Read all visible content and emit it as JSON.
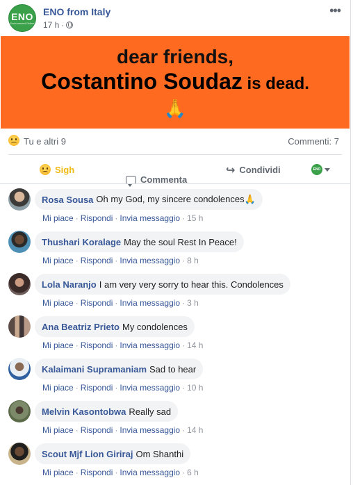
{
  "post": {
    "page_name": "ENO from Italy",
    "avatar_text": "ENO",
    "avatar_subtext": "Environment Online",
    "time": "17 h",
    "dot": "·",
    "more_label": "•••"
  },
  "banner": {
    "line1": "dear friends,",
    "name": "Costantino Soudaz",
    "line2_rest": " is dead.",
    "emoji": "🙏",
    "background": "#ff6a21"
  },
  "reactions": {
    "summary": "Tu e altri 9",
    "comments": "Commenti: 7",
    "icon": "sad-icon"
  },
  "actions": {
    "sigh": "Sigh",
    "comment": "Commenta",
    "share": "Condividi",
    "share_icon": "↪"
  },
  "comment_action_labels": {
    "like": "Mi piace",
    "reply": "Rispondi",
    "message": "Invia messaggio",
    "sep": "·"
  },
  "comments": [
    {
      "author": "Rosa Sousa",
      "text": "Oh my God, my sincere condolences🙏",
      "time": "15 h"
    },
    {
      "author": "Thushari Koralage",
      "text": "May the soul Rest In Peace!",
      "time": "8 h"
    },
    {
      "author": "Lola Naranjo",
      "text": "I am very very sorry to hear this. Condolences",
      "time": "3 h"
    },
    {
      "author": "Ana Beatriz Prieto",
      "text": "My condolences",
      "time": "14 h"
    },
    {
      "author": "Kalaimani Supramaniam",
      "text": "Sad to hear",
      "time": "10 h"
    },
    {
      "author": "Melvin Kasontobwa",
      "text": "Really sad",
      "time": "14 h"
    },
    {
      "author": "Scout Mjf Lion Giriraj",
      "text": "Om Shanthi",
      "time": "6 h"
    }
  ],
  "colors": {
    "link_blue": "#385898",
    "banner_orange": "#ff6a21",
    "eno_green": "#3aa14a",
    "sigh_yellow": "#f0ba15"
  }
}
